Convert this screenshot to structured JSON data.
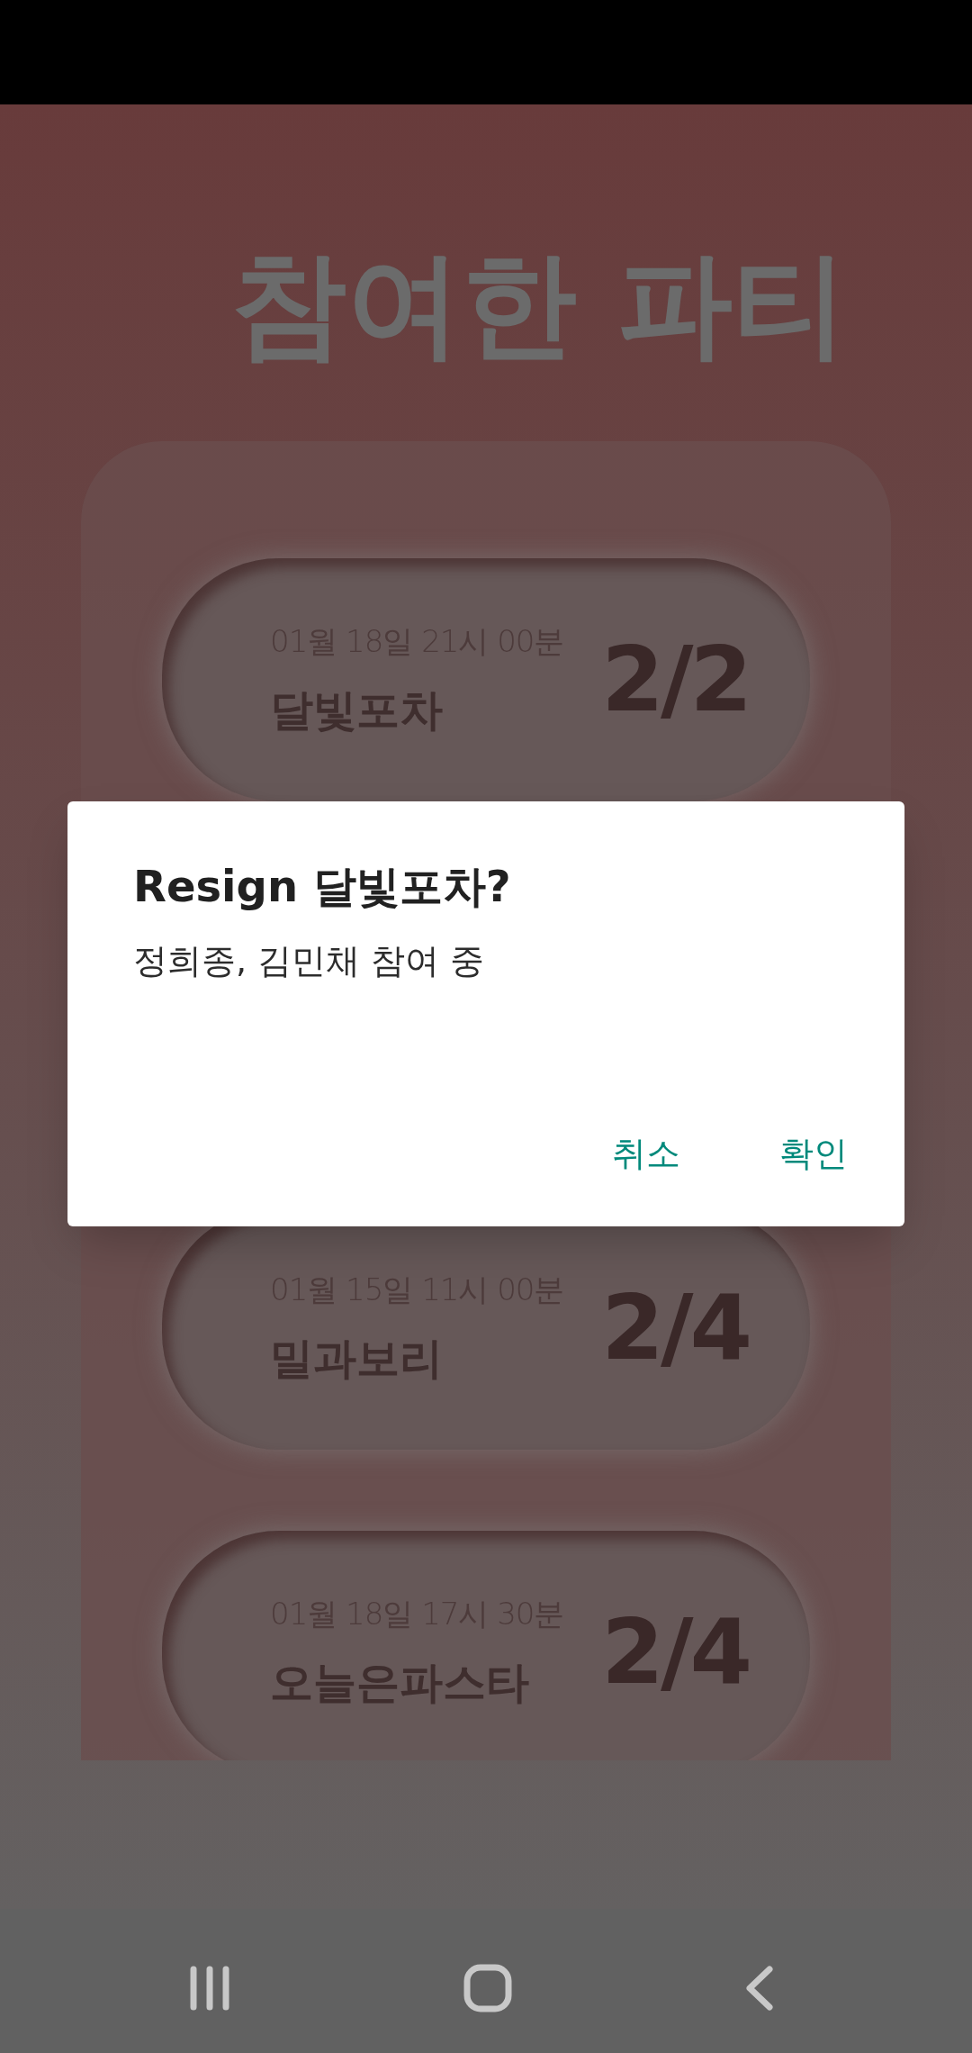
{
  "screen_title": "참여한 파티",
  "parties": [
    {
      "date": "01월 18일 21시 00분",
      "name": "달빛포차",
      "count": "2/2"
    },
    {
      "date": "01월 15일 11시 00분",
      "name": "밀과보리",
      "count": "2/4"
    },
    {
      "date": "01월 18일 17시 30분",
      "name": "오늘은파스타",
      "count": "2/4"
    }
  ],
  "dialog": {
    "title": "Resign 달빛포차?",
    "message": "정희종, 김민채 참여 중",
    "buttons": [
      "취소",
      "확인"
    ]
  }
}
